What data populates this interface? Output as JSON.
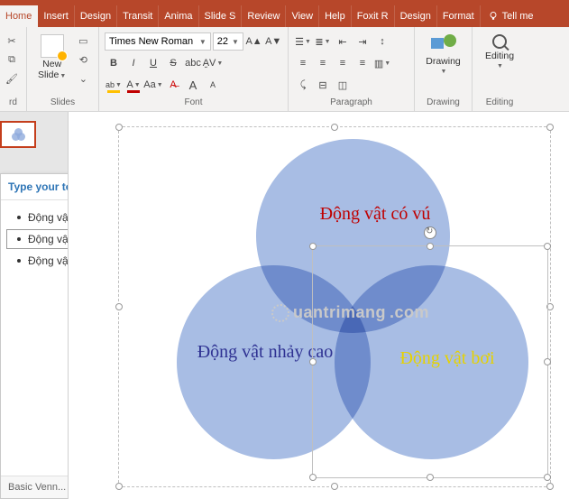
{
  "tabs": {
    "home": "Home",
    "insert": "Insert",
    "design": "Design",
    "transitions": "Transit",
    "animations": "Anima",
    "slideshow": "Slide S",
    "review": "Review",
    "view": "View",
    "help": "Help",
    "foxit": "Foxit R",
    "design2": "Design",
    "format": "Format",
    "tellme": "Tell me"
  },
  "ribbon": {
    "clipboard": {
      "label": "rd"
    },
    "slides": {
      "new_slide": "New\nSlide",
      "label": "Slides"
    },
    "font": {
      "name": "Times New Roman",
      "size": "22",
      "label": "Font",
      "bold": "B",
      "italic": "I",
      "underline": "U",
      "strike": "S",
      "shadow": "abc",
      "spacing": "AV",
      "highlight": "ab",
      "color": "A",
      "case": "Aa",
      "clear": "A",
      "grow": "A",
      "shrink": "A"
    },
    "paragraph": {
      "label": "Paragraph"
    },
    "drawing": {
      "label": "Drawing"
    },
    "editing": {
      "label": "Editing"
    }
  },
  "textpane": {
    "title": "Type your text here",
    "items": [
      "Động vật có vú",
      "Động vật bơi",
      "Động vật nhảy cao"
    ],
    "selected_index": 1,
    "footer": "Basic Venn..."
  },
  "venn": {
    "circle1": "Động vật có vú",
    "circle2": "Động vật nhảy cao",
    "circle3": "Động vật bơi"
  },
  "watermark": "uantrimang"
}
